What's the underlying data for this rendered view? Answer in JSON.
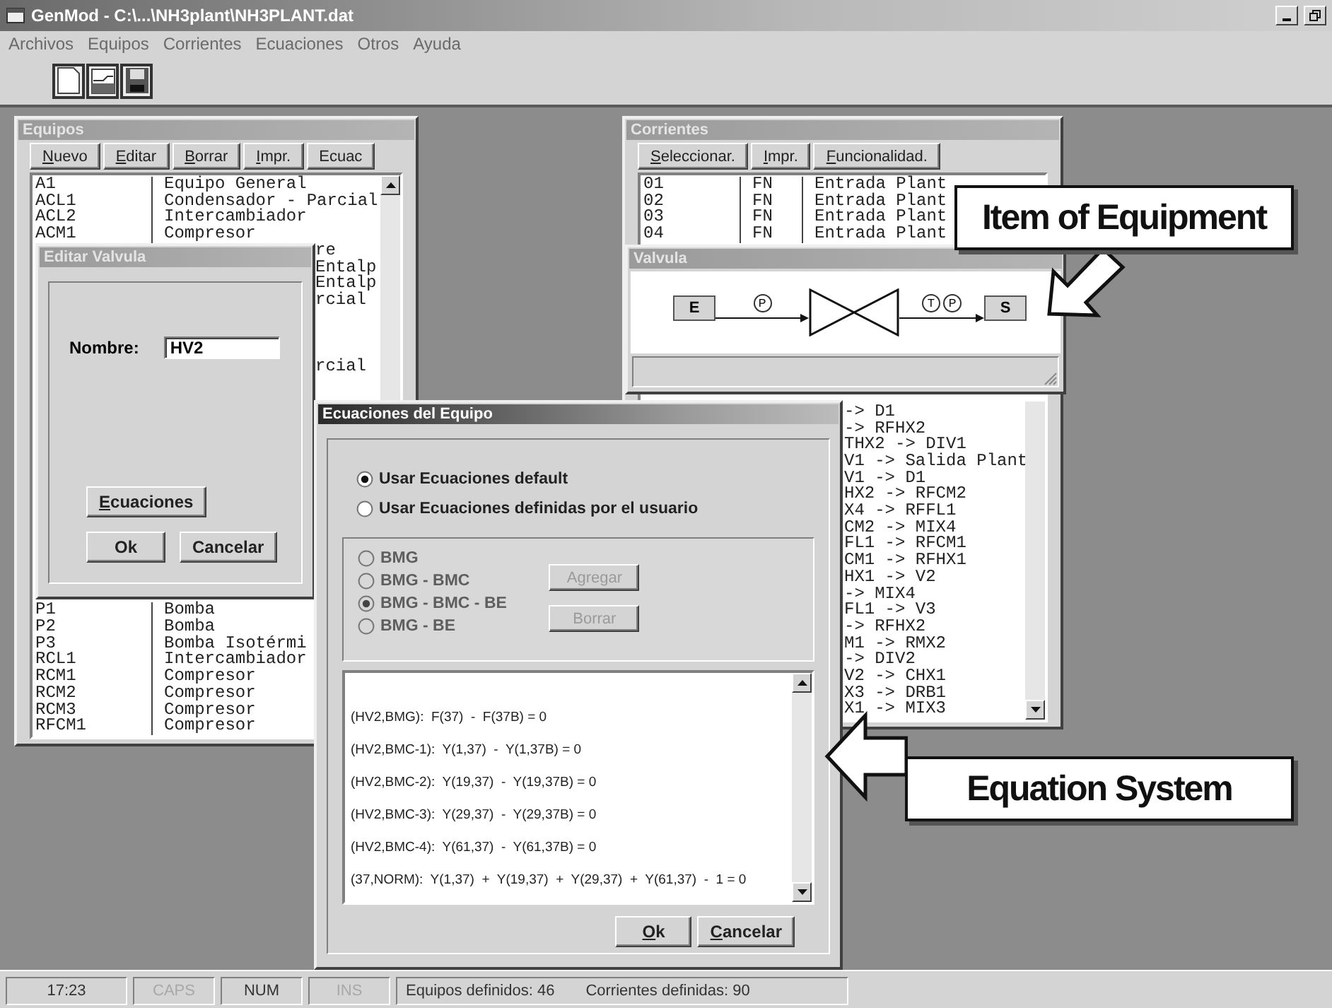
{
  "window": {
    "title": "GenMod - C:\\...\\NH3plant\\NH3PLANT.dat"
  },
  "menu": [
    "Archivos",
    "Equipos",
    "Corrientes",
    "Ecuaciones",
    "Otros",
    "Ayuda"
  ],
  "equipos": {
    "title": "Equipos",
    "buttons": [
      {
        "label": "Nuevo",
        "mnemonic": true
      },
      {
        "label": "Editar",
        "mnemonic": true
      },
      {
        "label": "Borrar",
        "mnemonic": true
      },
      {
        "label": "Impr.",
        "mnemonic": true
      },
      {
        "label": "Ecuac",
        "mnemonic": false
      }
    ],
    "rows_upper": [
      {
        "code": "A1",
        "description": "Equipo General"
      },
      {
        "code": "ACL1",
        "description": "Condensador - Parcial"
      },
      {
        "code": "ACL2",
        "description": "Intercambiador"
      },
      {
        "code": "ACM1",
        "description": "Compresor"
      }
    ],
    "fragments": [
      "re",
      "Entalp",
      "Entalp",
      "rcial"
    ],
    "fragments_lower": [
      "rcial"
    ],
    "rows_lower": [
      {
        "code": "P1",
        "description": "Bomba"
      },
      {
        "code": "P2",
        "description": "Bomba"
      },
      {
        "code": "P3",
        "description": "Bomba Isotérmi"
      },
      {
        "code": "RCL1",
        "description": "Intercambiador"
      },
      {
        "code": "RCM1",
        "description": "Compresor"
      },
      {
        "code": "RCM2",
        "description": "Compresor"
      },
      {
        "code": "RCM3",
        "description": "Compresor"
      },
      {
        "code": "RFCM1",
        "description": "Compresor"
      }
    ]
  },
  "corrientes": {
    "title": "Corrientes",
    "buttons": [
      {
        "label": "Seleccionar.",
        "mnemonic": true
      },
      {
        "label": "Impr.",
        "mnemonic": true
      },
      {
        "label": "Funcionalidad.",
        "mnemonic": true
      }
    ],
    "rows_upper": [
      {
        "code": "01",
        "type": "FN",
        "description": "Entrada Plant"
      },
      {
        "code": "02",
        "type": "FN",
        "description": "Entrada Plant"
      },
      {
        "code": "03",
        "type": "FN",
        "description": "Entrada Plant"
      },
      {
        "code": "04",
        "type": "FN",
        "description": "Entrada Plant"
      }
    ],
    "fragments": [
      "-> D1",
      "-> RFHX2",
      "THX2 -> DIV1",
      "V1 -> Salida Plant",
      "V1 -> D1",
      "HX2 -> RFCM2",
      "X4 -> RFFL1",
      "CM2 -> MIX4",
      "FL1 -> RFCM1",
      "CM1 -> RFHX1",
      "HX1 -> V2",
      "-> MIX4",
      "FL1 -> V3",
      "-> RFHX2",
      "M1 -> RMX2",
      "-> DIV2",
      "V2 -> CHX1",
      "X3 -> DRB1",
      "X1 -> MIX3"
    ]
  },
  "editar": {
    "title": "Editar Valvula",
    "name_label": "Nombre:",
    "name_value": "HV2",
    "buttons": [
      {
        "label": "Ecuaciones",
        "mnemonic": true
      },
      {
        "label": "Ok",
        "mnemonic": false
      },
      {
        "label": "Cancelar",
        "mnemonic": false
      }
    ]
  },
  "valvula": {
    "title": "Valvula",
    "inlet": "E",
    "outlet": "S",
    "inlet_sensors": [
      "P"
    ],
    "outlet_sensors": [
      "T",
      "P"
    ]
  },
  "ecuaciones": {
    "title": "Ecuaciones del Equipo",
    "options": [
      {
        "label": "Usar Ecuaciones default",
        "selected": true
      },
      {
        "label": "Usar Ecuaciones definidas por el usuario",
        "selected": false
      }
    ],
    "group": {
      "disabled": true,
      "options": [
        {
          "label": "BMG",
          "selected": false
        },
        {
          "label": "BMG - BMC",
          "selected": false
        },
        {
          "label": "BMG - BMC - BE",
          "selected": true
        },
        {
          "label": "BMG - BE",
          "selected": false
        }
      ],
      "buttons": [
        "Agregar",
        "Borrar"
      ]
    },
    "equations": [
      "(HV2,BMG):  F(37)  -  F(37B) = 0",
      "(HV2,BMC-1):  Y(1,37)  -  Y(1,37B) = 0",
      "(HV2,BMC-2):  Y(19,37)  -  Y(19,37B) = 0",
      "(HV2,BMC-3):  Y(29,37)  -  Y(29,37B) = 0",
      "(HV2,BMC-4):  Y(61,37)  -  Y(61,37B) = 0",
      "(37,NORM):  Y(1,37)  +  Y(19,37)  +  Y(29,37)  +  Y(61,37)  -  1 = 0"
    ],
    "buttons": [
      {
        "label": "Ok",
        "mnemonic": true
      },
      {
        "label": "Cancelar",
        "mnemonic": true
      }
    ]
  },
  "callouts": [
    {
      "text": "Item of Equipment",
      "kind": "down-left"
    },
    {
      "text": "Equation System",
      "kind": "left"
    }
  ],
  "status_bar": {
    "cells": [
      {
        "text": "17:23",
        "disabled": false
      },
      {
        "text": "CAPS",
        "disabled": true
      },
      {
        "text": "NUM",
        "disabled": false
      },
      {
        "text": "INS",
        "disabled": true
      }
    ],
    "info": [
      "Equipos definidos: 46",
      "Corrientes definidas: 90"
    ]
  }
}
